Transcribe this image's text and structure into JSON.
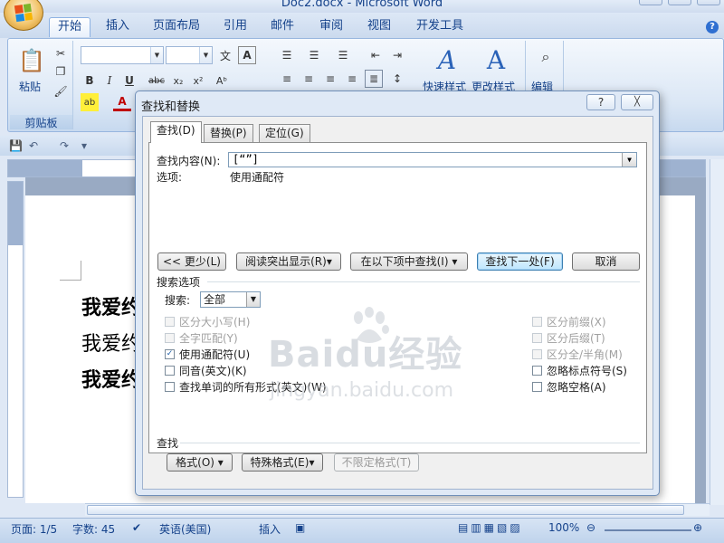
{
  "window": {
    "title": "Doc2.docx - Microsoft Word"
  },
  "ribbon": {
    "tabs": [
      "开始",
      "插入",
      "页面布局",
      "引用",
      "邮件",
      "审阅",
      "视图",
      "开发工具"
    ],
    "groups": {
      "clipboard": "剪贴板",
      "paste_label": "粘贴",
      "quick_styles": "快速样式",
      "change_styles": "更改样式",
      "editing": "编辑"
    }
  },
  "document": {
    "lines": [
      "我爱约",
      "我爱约",
      "我爱约"
    ]
  },
  "dialog": {
    "title": "查找和替换",
    "help_label": "?",
    "close_label": "╳",
    "tabs": [
      "查找(D)",
      "替换(P)",
      "定位(G)"
    ],
    "find_label": "查找内容(N):",
    "find_value": "[“”]",
    "options_label": "选项:",
    "options_value": "使用通配符",
    "buttons": {
      "less": "<< 更少(L)",
      "reading_highlight": "阅读突出显示(R)▾",
      "find_in": "在以下项中查找(I) ▾",
      "find_next": "查找下一处(F)",
      "cancel": "取消"
    },
    "search_options_label": "搜索选项",
    "search_label": "搜索:",
    "search_value": "全部",
    "checkboxes_left": [
      {
        "label": "区分大小写(H)",
        "checked": false,
        "disabled": true
      },
      {
        "label": "全字匹配(Y)",
        "checked": false,
        "disabled": true
      },
      {
        "label": "使用通配符(U)",
        "checked": true,
        "disabled": false
      },
      {
        "label": "同音(英文)(K)",
        "checked": false,
        "disabled": false
      },
      {
        "label": "查找单词的所有形式(英文)(W)",
        "checked": false,
        "disabled": false
      }
    ],
    "checkboxes_right": [
      {
        "label": "区分前缀(X)",
        "checked": false,
        "disabled": true
      },
      {
        "label": "区分后缀(T)",
        "checked": false,
        "disabled": true
      },
      {
        "label": "区分全/半角(M)",
        "checked": false,
        "disabled": true
      },
      {
        "label": "忽略标点符号(S)",
        "checked": false,
        "disabled": false
      },
      {
        "label": "忽略空格(A)",
        "checked": false,
        "disabled": false
      }
    ],
    "find_section_label": "查找",
    "bottom_buttons": {
      "format": "格式(O) ▾",
      "special": "特殊格式(E)▾",
      "no_format": "不限定格式(T)"
    }
  },
  "watermark": {
    "brand": "Baidu经验",
    "url": "jingyan.baidu.com"
  },
  "statusbar": {
    "page": "页面: 1/5",
    "words": "字数: 45",
    "language": "英语(美国)",
    "insert_mode": "插入",
    "zoom": "100%"
  }
}
